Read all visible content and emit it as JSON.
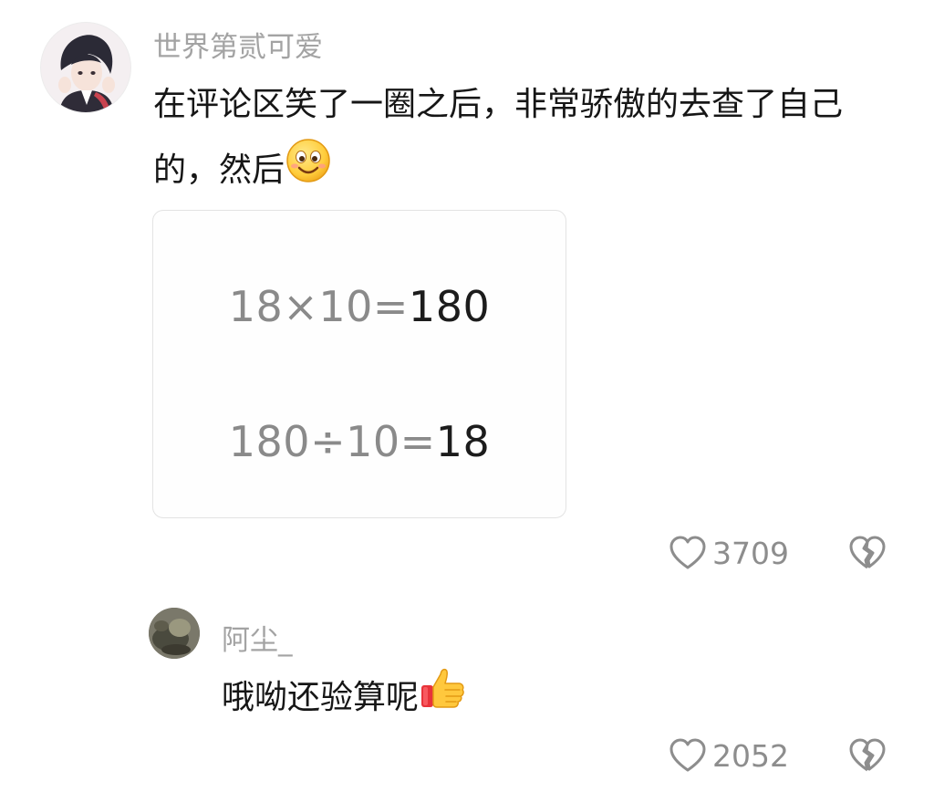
{
  "comments": [
    {
      "username": "世界第贰可爱",
      "text": "在评论区笑了一圈之后，非常骄傲的去查了自己的，然后",
      "emoji": "smile-emoji",
      "attachment": {
        "lines": [
          {
            "lhs": "18×10=",
            "rhs": "180"
          },
          {
            "lhs": "180÷10=",
            "rhs": "18"
          }
        ]
      },
      "likes": "3709",
      "icons": {
        "like": "heart-outline-icon",
        "dislike": "broken-heart-icon"
      }
    },
    {
      "username": "阿尘_",
      "text": "哦呦还验算呢",
      "emoji": "thumbs-up-emoji",
      "likes": "2052",
      "icons": {
        "like": "heart-outline-icon",
        "dislike": "broken-heart-icon"
      }
    }
  ],
  "colors": {
    "username": "#a3a3a3",
    "text": "#161616",
    "muted": "#8d8d8d",
    "equation_light": "#8a8a8a",
    "equation_dark": "#1c1c1c",
    "card_border": "#e3e3e3"
  }
}
